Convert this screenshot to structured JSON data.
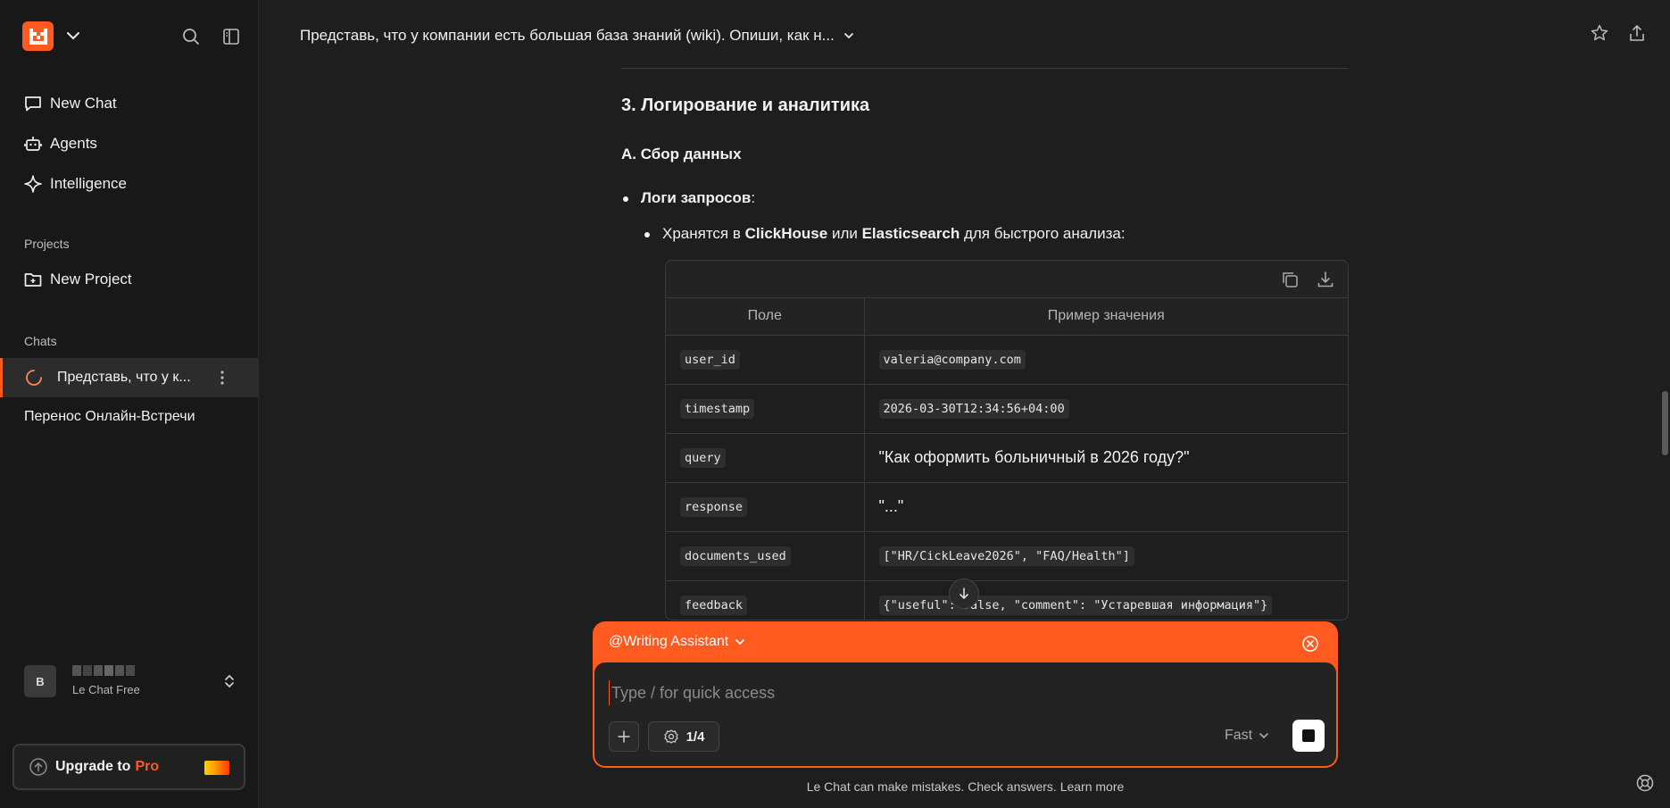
{
  "sidebar": {
    "nav": [
      {
        "label": "New Chat",
        "icon": "chat-bubble-icon"
      },
      {
        "label": "Agents",
        "icon": "robot-icon"
      },
      {
        "label": "Intelligence",
        "icon": "sparkle-icon"
      }
    ],
    "projects_label": "Projects",
    "new_project_label": "New Project",
    "chats_label": "Chats",
    "chats": [
      {
        "title": "Представь, что у к..."
      },
      {
        "title": "Перенос Онлайн-Встречи"
      }
    ],
    "user": {
      "avatar_letter": "B",
      "plan": "Le Chat Free"
    },
    "upgrade": {
      "text": "Upgrade to",
      "pro": "Pro"
    }
  },
  "header": {
    "title": "Представь, что у компании есть большая база знаний (wiki). Опиши, как н..."
  },
  "content": {
    "heading": "3. Логирование и аналитика",
    "subheading": "A. Сбор данных",
    "bullet1_bold": "Логи запросов",
    "bullet1_rest": ":",
    "bullet2_pre": "Хранятся в ",
    "bullet2_b1": "ClickHouse",
    "bullet2_mid": " или ",
    "bullet2_b2": "Elasticsearch",
    "bullet2_post": " для быстрого анализа:",
    "table": {
      "headers": [
        "Поле",
        "Пример значения"
      ],
      "rows": [
        {
          "field": "user_id",
          "value": "valeria@company.com",
          "mono": true
        },
        {
          "field": "timestamp",
          "value": "2026-03-30T12:34:56+04:00",
          "mono": true
        },
        {
          "field": "query",
          "value": "\"Как оформить больничный в 2026 году?\"",
          "mono": false
        },
        {
          "field": "response",
          "value": "\"...\"",
          "mono": false
        },
        {
          "field": "documents_used",
          "value": "[\"HR/CickLeave2026\", \"FAQ/Health\"]",
          "mono": true
        },
        {
          "field": "feedback",
          "value": "{\"useful\": false, \"comment\": \"Устаревшая информация\"}",
          "mono": true
        }
      ]
    }
  },
  "composer": {
    "agent": "@Writing Assistant",
    "placeholder": "Type / for quick access",
    "tools_count": "1/4",
    "model": "Fast"
  },
  "footer": {
    "note": "Le Chat can make mistakes. Check answers. Learn more"
  },
  "colors": {
    "accent": "#ff5a1f",
    "background": "#1e1e1e",
    "sidebar": "#181818"
  }
}
